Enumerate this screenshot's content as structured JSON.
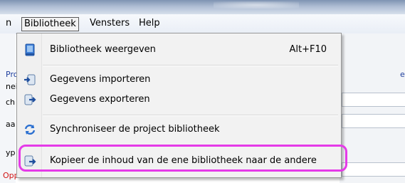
{
  "menubar": {
    "cut_item": "n",
    "active_menu": "Bibliotheek",
    "vensters": "Vensters",
    "help": "Help"
  },
  "background": {
    "left_fragments": [
      "Pro",
      "nei",
      "ch",
      "aa",
      "yp"
    ],
    "red_fragment": "Oppervlakte :",
    "right_fragment": "e"
  },
  "dropdown": {
    "items": [
      {
        "label": "Bibliotheek weergeven",
        "shortcut": "Alt+F10",
        "icon": "library-book-icon"
      },
      {
        "label": "Gegevens importeren",
        "icon": "import-data-icon"
      },
      {
        "label": "Gegevens exporteren",
        "icon": "export-data-icon"
      },
      {
        "label": "Synchroniseer de project bibliotheek",
        "icon": "sync-arrows-icon"
      },
      {
        "label": "Kopieer de inhoud van de ene bibliotheek naar de andere",
        "icon": "copy-library-icon"
      }
    ]
  },
  "colors": {
    "highlight": "#e53ae8",
    "menu_bg": "#f2f2f2"
  }
}
